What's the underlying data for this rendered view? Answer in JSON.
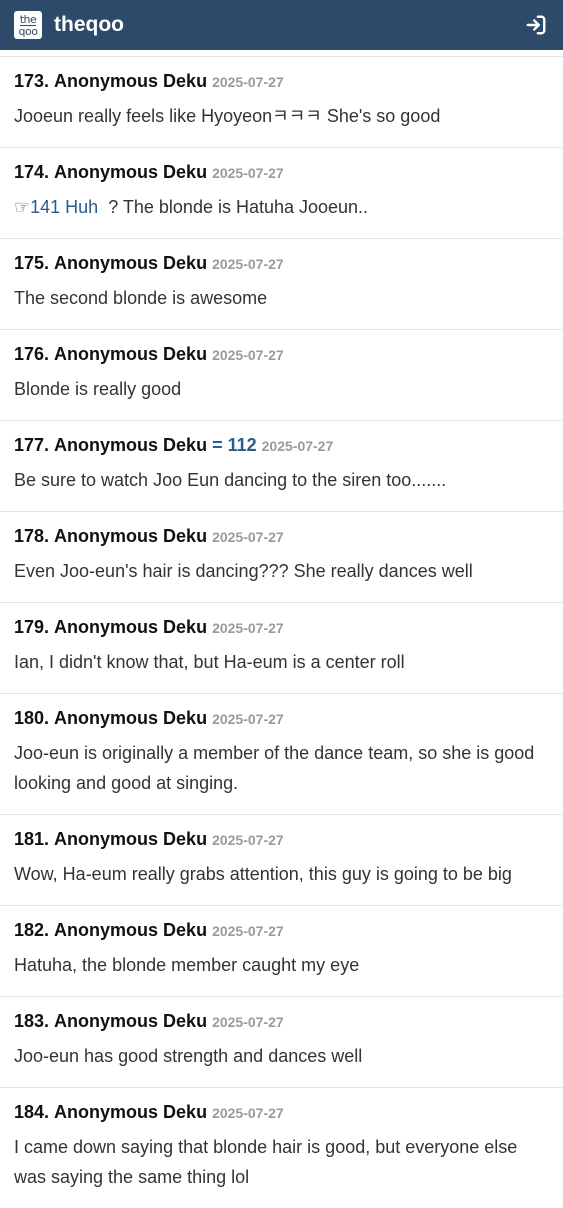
{
  "colors": {
    "brand": "#2d4a6b",
    "link": "#2b5c8a"
  },
  "header": {
    "logo_top": "the",
    "logo_bottom": "qoo",
    "site_name": "theqoo",
    "login_icon": "login-icon"
  },
  "comments": [
    {
      "number": "173.",
      "author": "Anonymous Deku",
      "date": "2025-07-27",
      "text": "Jooeun really feels like Hyoyeonㅋㅋㅋ She's so good"
    },
    {
      "number": "174.",
      "author": "Anonymous Deku",
      "date": "2025-07-27",
      "reply_link": "☞141 Huh",
      "text": "  ? The blonde is Hatuha Jooeun.."
    },
    {
      "number": "175.",
      "author": "Anonymous Deku",
      "date": "2025-07-27",
      "text": "The second blonde is awesome"
    },
    {
      "number": "176.",
      "author": "Anonymous Deku",
      "date": "2025-07-27",
      "text": "Blonde is really good"
    },
    {
      "number": "177.",
      "author": "Anonymous Deku",
      "ref": "= 112",
      "date": "2025-07-27",
      "text": "Be sure to watch Joo Eun dancing to the siren too......."
    },
    {
      "number": "178.",
      "author": "Anonymous Deku",
      "date": "2025-07-27",
      "text": "Even Joo-eun's hair is dancing??? She really dances well"
    },
    {
      "number": "179.",
      "author": "Anonymous Deku",
      "date": "2025-07-27",
      "text": "Ian, I didn't know that, but Ha-eum is a center roll"
    },
    {
      "number": "180.",
      "author": "Anonymous Deku",
      "date": "2025-07-27",
      "text": "Joo-eun is originally a member of the dance team, so she is good looking and good at singing."
    },
    {
      "number": "181.",
      "author": "Anonymous Deku",
      "date": "2025-07-27",
      "text": "Wow, Ha-eum really grabs attention, this guy is going to be big"
    },
    {
      "number": "182.",
      "author": "Anonymous Deku",
      "date": "2025-07-27",
      "text": "Hatuha, the blonde member caught my eye"
    },
    {
      "number": "183.",
      "author": "Anonymous Deku",
      "date": "2025-07-27",
      "text": "Joo-eun has good strength and dances well"
    },
    {
      "number": "184.",
      "author": "Anonymous Deku",
      "date": "2025-07-27",
      "text": "I came down saying that blonde hair is good, but everyone else was saying the same thing lol"
    }
  ]
}
